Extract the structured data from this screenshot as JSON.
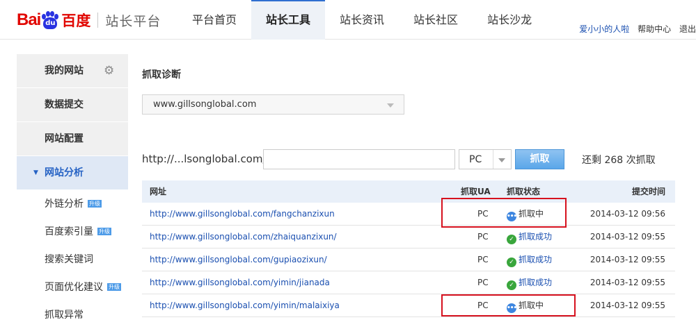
{
  "header": {
    "logo_bai": "Bai",
    "logo_du": "du",
    "logo_cn": "百度",
    "logo_sub": "站长平台",
    "nav": [
      "平台首页",
      "站长工具",
      "站长资讯",
      "站长社区",
      "站长沙龙"
    ],
    "nav_active_index": 1,
    "user_name": "爱小小的人啦",
    "help": "帮助中心",
    "exit": "退出"
  },
  "sidebar": {
    "items": [
      {
        "label": "我的网站"
      },
      {
        "label": "数据提交"
      },
      {
        "label": "网站配置"
      },
      {
        "label": "网站分析"
      }
    ],
    "subitems": [
      {
        "label": "外链分析",
        "badge": "升级"
      },
      {
        "label": "百度索引量",
        "badge": "升级"
      },
      {
        "label": "搜索关键词",
        "badge": ""
      },
      {
        "label": "页面优化建议",
        "badge": "升级"
      },
      {
        "label": "抓取异常",
        "badge": ""
      }
    ]
  },
  "main": {
    "title": "抓取诊断",
    "site_select": "www.gillsonglobal.com",
    "url_prefix": "http://...lsonglobal.com/",
    "url_value": "",
    "ua_value": "PC",
    "fetch_button": "抓取",
    "remaining": "还剩 268 次抓取"
  },
  "table": {
    "headers": {
      "url": "网址",
      "ua": "抓取UA",
      "status": "抓取状态",
      "time": "提交时间"
    },
    "rows": [
      {
        "url": "http://www.gillsonglobal.com/fangchanzixun",
        "ua": "PC",
        "status": "抓取中",
        "state": "busy",
        "time": "2014-03-12 09:56"
      },
      {
        "url": "http://www.gillsonglobal.com/zhaiquanzixun/",
        "ua": "PC",
        "status": "抓取成功",
        "state": "ok",
        "time": "2014-03-12 09:55"
      },
      {
        "url": "http://www.gillsonglobal.com/gupiaozixun/",
        "ua": "PC",
        "status": "抓取成功",
        "state": "ok",
        "time": "2014-03-12 09:55"
      },
      {
        "url": "http://www.gillsonglobal.com/yimin/jianada",
        "ua": "PC",
        "status": "抓取成功",
        "state": "ok",
        "time": "2014-03-12 09:55"
      },
      {
        "url": "http://www.gillsonglobal.com/yimin/malaixiya",
        "ua": "PC",
        "status": "抓取中",
        "state": "busy",
        "time": "2014-03-12 09:55"
      }
    ]
  },
  "colors": {
    "brand_red": "#e10601",
    "brand_blue": "#2932e1",
    "link_blue": "#1a4fb0",
    "highlight_red": "#d6111e"
  }
}
